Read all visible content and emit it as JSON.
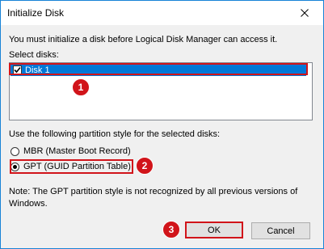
{
  "window": {
    "title": "Initialize Disk"
  },
  "intro_text": "You must initialize a disk before Logical Disk Manager can access it.",
  "select_disks": {
    "label": "Select disks:",
    "items": [
      {
        "label": "Disk 1",
        "checked": true,
        "selected": true
      }
    ]
  },
  "partition": {
    "label": "Use the following partition style for the selected disks:",
    "options": [
      {
        "label": "MBR (Master Boot Record)",
        "checked": false
      },
      {
        "label": "GPT (GUID Partition Table)",
        "checked": true
      }
    ]
  },
  "note": {
    "line1": "Note: The GPT partition style is not recognized by all previous versions of",
    "line2": "Windows."
  },
  "buttons": {
    "ok": "OK",
    "cancel": "Cancel"
  },
  "annotations": {
    "step1": "1",
    "step2": "2",
    "step3": "3"
  },
  "colors": {
    "highlight_red": "#d1141a",
    "selection_blue": "#0078d7",
    "window_border": "#1883d7",
    "dialog_background": "#f0f0f0"
  },
  "icons": {
    "close": "close-icon",
    "checkbox": "checkmark-icon"
  }
}
